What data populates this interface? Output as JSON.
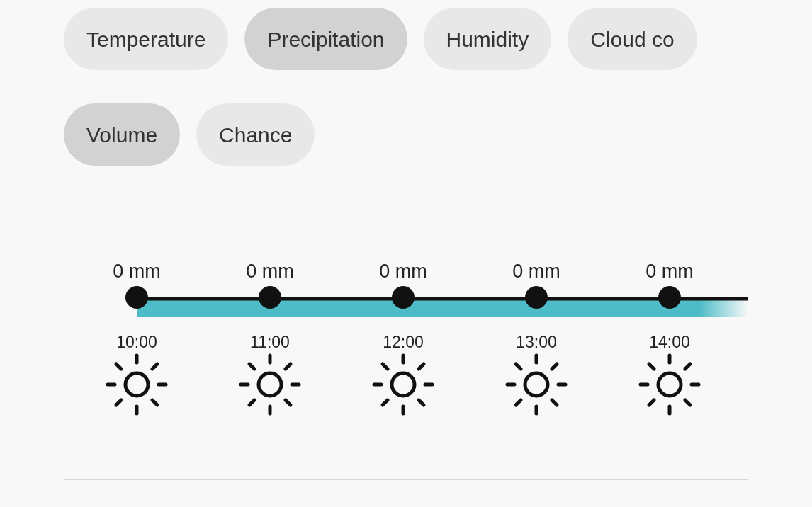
{
  "categories": [
    {
      "label": "Temperature",
      "selected": false
    },
    {
      "label": "Precipitation",
      "selected": true
    },
    {
      "label": "Humidity",
      "selected": false
    },
    {
      "label": "Cloud co",
      "selected": false
    }
  ],
  "modes": [
    {
      "label": "Volume",
      "selected": true
    },
    {
      "label": "Chance",
      "selected": false
    }
  ],
  "hours": [
    {
      "amount": "0 mm",
      "time": "10:00"
    },
    {
      "amount": "0 mm",
      "time": "11:00"
    },
    {
      "amount": "0 mm",
      "time": "12:00"
    },
    {
      "amount": "0 mm",
      "time": "13:00"
    },
    {
      "amount": "0 mm",
      "time": "14:00"
    }
  ]
}
